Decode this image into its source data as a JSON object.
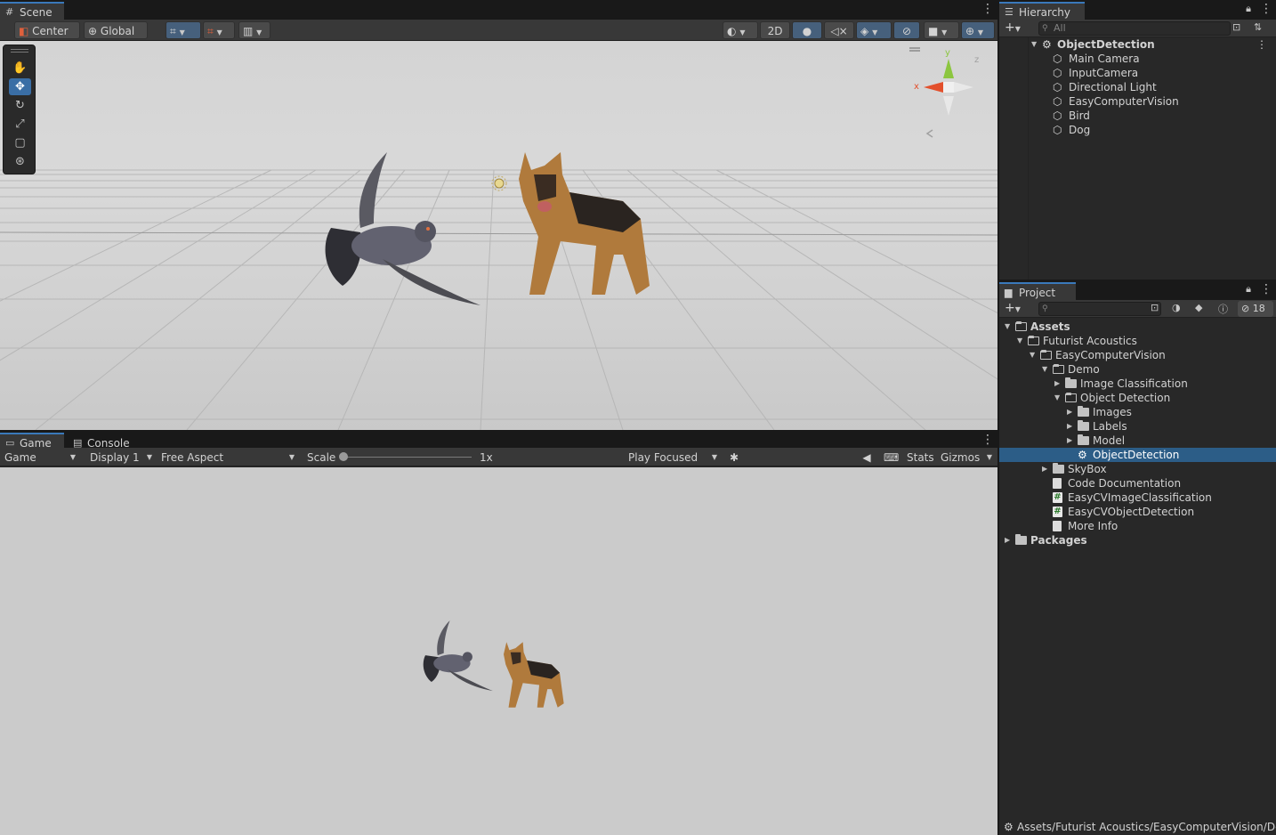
{
  "scene": {
    "tab": "Scene",
    "pivot": "Center",
    "space": "Global",
    "mode_2d": "2D"
  },
  "game": {
    "tabs": [
      "Game",
      "Console"
    ],
    "view_select": "Game",
    "display": "Display 1",
    "aspect": "Free Aspect",
    "scale_label": "Scale",
    "scale_value": "1x",
    "play_mode": "Play Focused",
    "stats": "Stats",
    "gizmos": "Gizmos"
  },
  "hierarchy": {
    "tab": "Hierarchy",
    "search_placeholder": "All",
    "root": "ObjectDetection",
    "items": [
      "Main Camera",
      "InputCamera",
      "Directional Light",
      "EasyComputerVision",
      "Bird",
      "Dog"
    ]
  },
  "project": {
    "tab": "Project",
    "hidden_count": "18",
    "tree": [
      {
        "label": "Assets",
        "depth": 0,
        "type": "folder",
        "expanded": true,
        "bold": true
      },
      {
        "label": "Futurist Acoustics",
        "depth": 1,
        "type": "folder",
        "expanded": true
      },
      {
        "label": "EasyComputerVision",
        "depth": 2,
        "type": "folder",
        "expanded": true
      },
      {
        "label": "Demo",
        "depth": 3,
        "type": "folder",
        "expanded": true
      },
      {
        "label": "Image Classification",
        "depth": 4,
        "type": "folder",
        "expanded": false
      },
      {
        "label": "Object Detection",
        "depth": 4,
        "type": "folder",
        "expanded": true
      },
      {
        "label": "Images",
        "depth": 5,
        "type": "folder",
        "expanded": false
      },
      {
        "label": "Labels",
        "depth": 5,
        "type": "folder",
        "expanded": false
      },
      {
        "label": "Model",
        "depth": 5,
        "type": "folder",
        "expanded": false
      },
      {
        "label": "ObjectDetection",
        "depth": 5,
        "type": "scene",
        "selected": true
      },
      {
        "label": "SkyBox",
        "depth": 3,
        "type": "folder",
        "expanded": false
      },
      {
        "label": "Code Documentation",
        "depth": 3,
        "type": "doc"
      },
      {
        "label": "EasyCVImageClassification",
        "depth": 3,
        "type": "script"
      },
      {
        "label": "EasyCVObjectDetection",
        "depth": 3,
        "type": "script"
      },
      {
        "label": "More Info",
        "depth": 3,
        "type": "doc"
      },
      {
        "label": "Packages",
        "depth": 0,
        "type": "folder",
        "expanded": false,
        "bold": true
      }
    ],
    "status_path": "Assets/Futurist Acoustics/EasyComputerVision/De"
  },
  "gizmo_axes": {
    "x": "x",
    "y": "y",
    "z": "z"
  }
}
